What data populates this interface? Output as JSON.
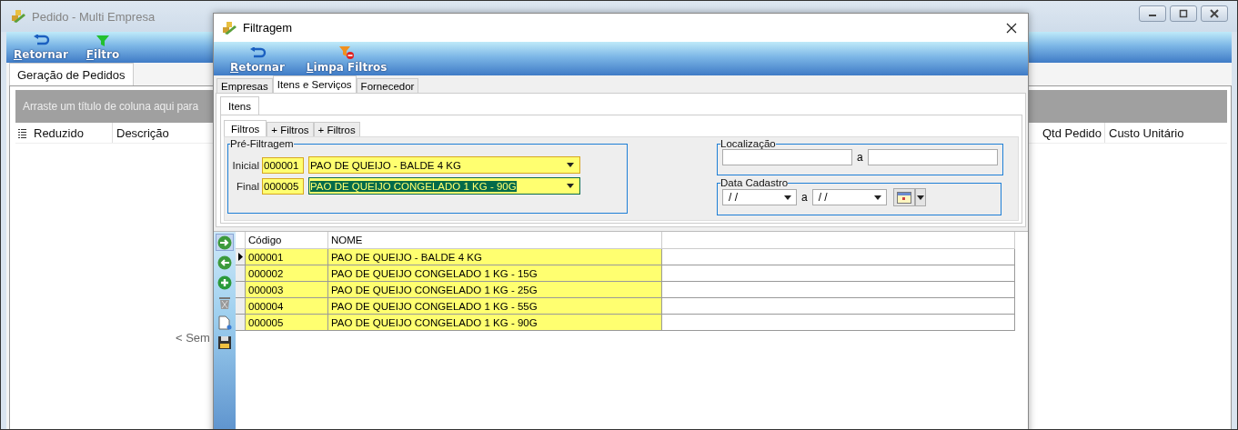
{
  "main_window": {
    "title": "Pedido - Multi Empresa",
    "toolbar": [
      {
        "label": "Retornar",
        "kind": "return"
      },
      {
        "label": "Filtro",
        "kind": "filter"
      }
    ],
    "tabs": [
      {
        "label": "Geração de Pedidos",
        "selected": true
      }
    ],
    "group_hint": "Arraste um título de coluna aqui para",
    "columns": [
      {
        "label": "Reduzido",
        "kind": "left"
      },
      {
        "label": "Descrição",
        "kind": "left"
      },
      {
        "label": "Qtd Pedido",
        "kind": "right"
      },
      {
        "label": "Custo Unitário",
        "kind": "right"
      }
    ],
    "empty_text": "< Sem"
  },
  "dialog": {
    "title": "Filtragem",
    "toolbar": [
      {
        "label": "Retornar",
        "kind": "return"
      },
      {
        "label": "Limpa Filtros",
        "kind": "clear_filter"
      }
    ],
    "tabs": [
      {
        "label": "Empresas",
        "selected": false
      },
      {
        "label": "Itens e Serviços",
        "selected": true
      },
      {
        "label": "Fornecedor",
        "selected": false
      }
    ],
    "subtabs": [
      {
        "label": "Itens",
        "selected": true
      }
    ],
    "filter_tabs": [
      {
        "label": "Filtros",
        "selected": true
      },
      {
        "label": "+ Filtros",
        "selected": false
      },
      {
        "label": "+ Filtros",
        "selected": false
      }
    ],
    "pre_filter": {
      "title": "Pré-Filtragem",
      "rows": [
        {
          "label": "Inicial",
          "code": "000001",
          "name": "PAO DE QUEIJO - BALDE 4 KG",
          "focused": false
        },
        {
          "label": "Final",
          "code": "000005",
          "name": "PAO DE QUEIJO CONGELADO 1 KG - 90G",
          "focused": true
        }
      ]
    },
    "location": {
      "title": "Localização",
      "separator": "a"
    },
    "date": {
      "title": "Data Cadastro",
      "from": "/ /",
      "separator": "a",
      "to": "/ /"
    },
    "side_tools": [
      {
        "kind": "next",
        "selected": true
      },
      {
        "kind": "previous",
        "selected": false
      },
      {
        "kind": "add",
        "selected": false
      },
      {
        "kind": "delete",
        "selected": false
      },
      {
        "kind": "document",
        "selected": false
      },
      {
        "kind": "save",
        "selected": false
      }
    ],
    "grid": {
      "columns": [
        "Código",
        "NOME"
      ],
      "rows": [
        {
          "code": "000001",
          "name": "PAO DE QUEIJO - BALDE 4 KG",
          "current": true
        },
        {
          "code": "000002",
          "name": "PAO DE QUEIJO CONGELADO 1 KG - 15G",
          "current": false
        },
        {
          "code": "000003",
          "name": "PAO DE QUEIJO CONGELADO 1 KG - 25G",
          "current": false
        },
        {
          "code": "000004",
          "name": "PAO DE QUEIJO CONGELADO 1 KG - 55G",
          "current": false
        },
        {
          "code": "000005",
          "name": "PAO DE QUEIJO CONGELADO 1 KG - 90G",
          "current": false
        }
      ]
    }
  }
}
